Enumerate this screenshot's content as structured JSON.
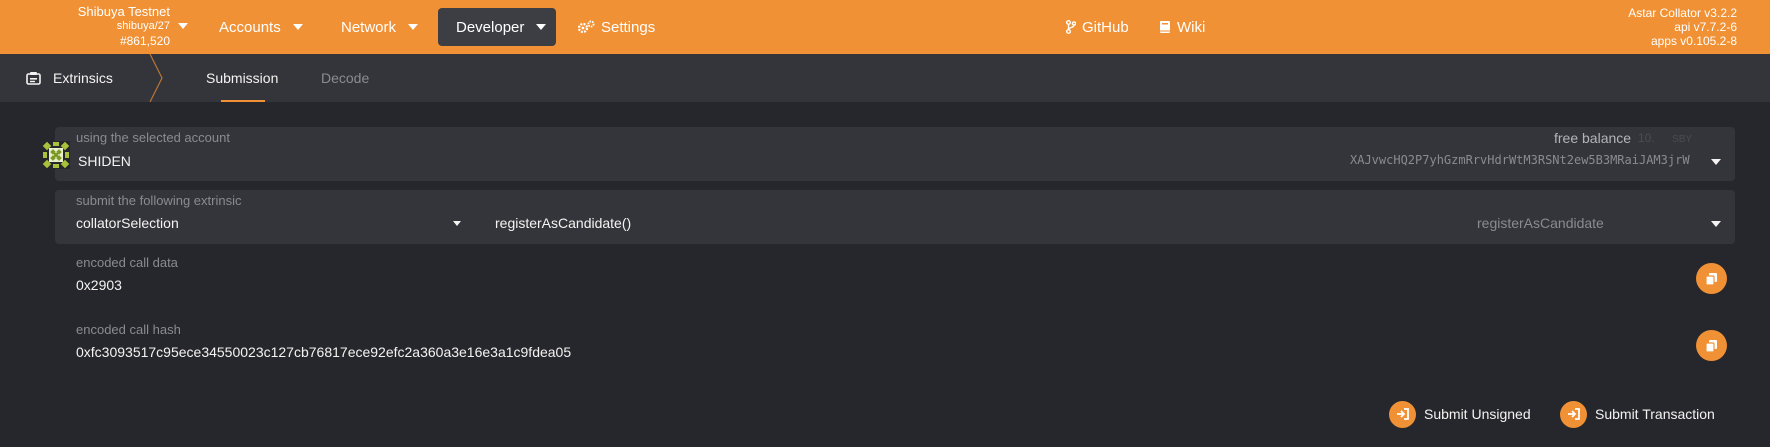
{
  "chain": {
    "name": "Shibuya Testnet",
    "spec": "shibuya/27",
    "block": "#861,520"
  },
  "nav": {
    "accounts": "Accounts",
    "network": "Network",
    "developer": "Developer",
    "settings": "Settings",
    "github": "GitHub",
    "wiki": "Wiki"
  },
  "versions": {
    "node": "Astar Collator v3.2.2",
    "api": "api v7.7.2-6",
    "apps": "apps v0.105.2-8"
  },
  "section": {
    "title": "Extrinsics",
    "tabs": [
      "Submission",
      "Decode"
    ]
  },
  "account": {
    "label": "using the selected account",
    "name": "SHIDEN",
    "balance_label": "free balance",
    "balance_value": "10.",
    "balance_unit": "SBY",
    "address": "XAJvwcHQ2P7yhGzmRrvHdrWtM3RSNt2ew5B3MRaiJAM3jrW"
  },
  "extrinsic": {
    "label": "submit the following extrinsic",
    "module": "collatorSelection",
    "call": "registerAsCandidate()",
    "method": "registerAsCandidate"
  },
  "encoded_data": {
    "label": "encoded call data",
    "value": "0x2903"
  },
  "encoded_hash": {
    "label": "encoded call hash",
    "value": "0xfc3093517c95ece34550023c127cb76817ece92efc2a360a3e16e3a1c9fdea05"
  },
  "actions": {
    "submit_unsigned": "Submit Unsigned",
    "submit_transaction": "Submit Transaction"
  },
  "colors": {
    "accent": "#f19135",
    "background": "#26272c",
    "panel": "#34353b"
  }
}
